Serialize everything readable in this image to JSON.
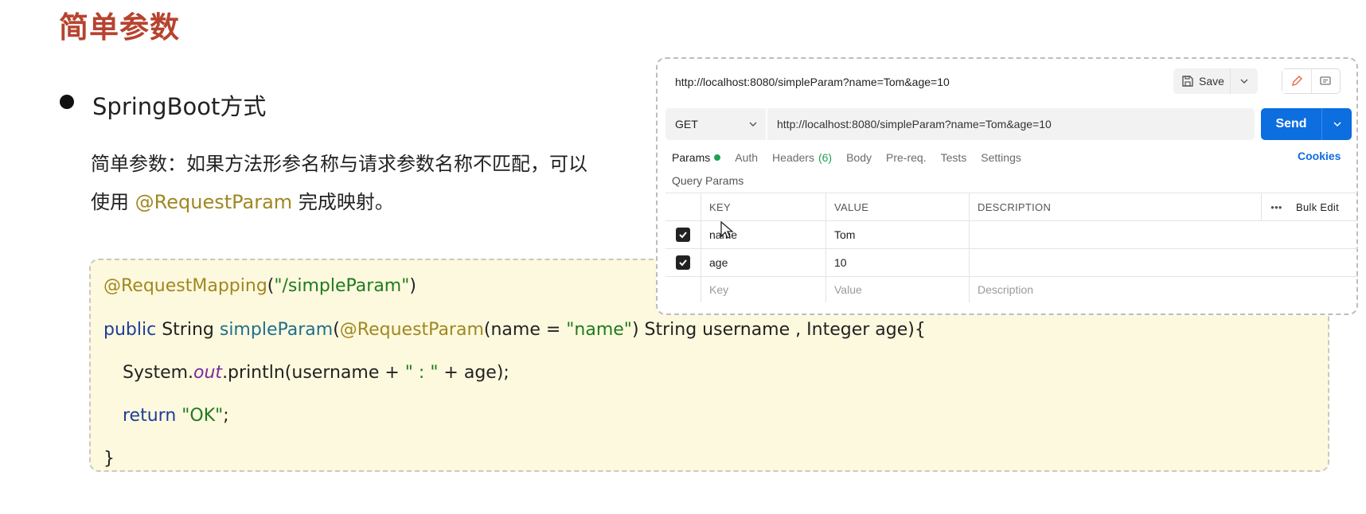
{
  "slide": {
    "title": "简单参数",
    "bullet": "SpringBoot方式",
    "desc_line1": "简单参数：如果方法形参名称与请求参数名称不匹配，可以",
    "desc_line2_pre": "使用 ",
    "desc_line2_anno": "@RequestParam",
    "desc_line2_post": " 完成映射。"
  },
  "code": {
    "l1_anno": "@RequestMapping",
    "l1_open": "(",
    "l1_str": "\"/simpleParam\"",
    "l1_close": ")",
    "l2_kw": "public",
    "l2_type": " String ",
    "l2_fn": "simpleParam",
    "l2_open": "(",
    "l2_anno": "@RequestParam",
    "l2_mid": "(name = ",
    "l2_str": "\"name\"",
    "l2_rest": ") String username , Integer age){",
    "l3_pre": "System.",
    "l3_out": "out",
    "l3_mid": ".println(username + ",
    "l3_str": "\" : \"",
    "l3_post": " + age);",
    "l4_kw": "return",
    "l4_sp": " ",
    "l4_str": "\"OK\"",
    "l4_end": ";",
    "l5": "}"
  },
  "postman": {
    "request_name": "http://localhost:8080/simpleParam?name=Tom&age=10",
    "save_label": "Save",
    "method": "GET",
    "url": "http://localhost:8080/simpleParam?name=Tom&age=10",
    "send_label": "Send",
    "tabs": {
      "params": "Params",
      "auth": "Auth",
      "headers": "Headers",
      "headers_count": "(6)",
      "body": "Body",
      "prereq": "Pre-req.",
      "tests": "Tests",
      "settings": "Settings"
    },
    "cookies": "Cookies",
    "query_params_label": "Query Params",
    "columns": {
      "key": "KEY",
      "value": "VALUE",
      "description": "DESCRIPTION",
      "more": "•••",
      "bulk_edit": "Bulk Edit"
    },
    "rows": [
      {
        "key": "name",
        "value": "Tom",
        "description": ""
      },
      {
        "key": "age",
        "value": "10",
        "description": ""
      }
    ],
    "placeholders": {
      "key": "Key",
      "value": "Value",
      "description": "Description"
    },
    "colors": {
      "send": "#0d6ee0",
      "params_dot": "#1fa055",
      "title": "#b7432f",
      "annotation": "#a08722"
    }
  }
}
